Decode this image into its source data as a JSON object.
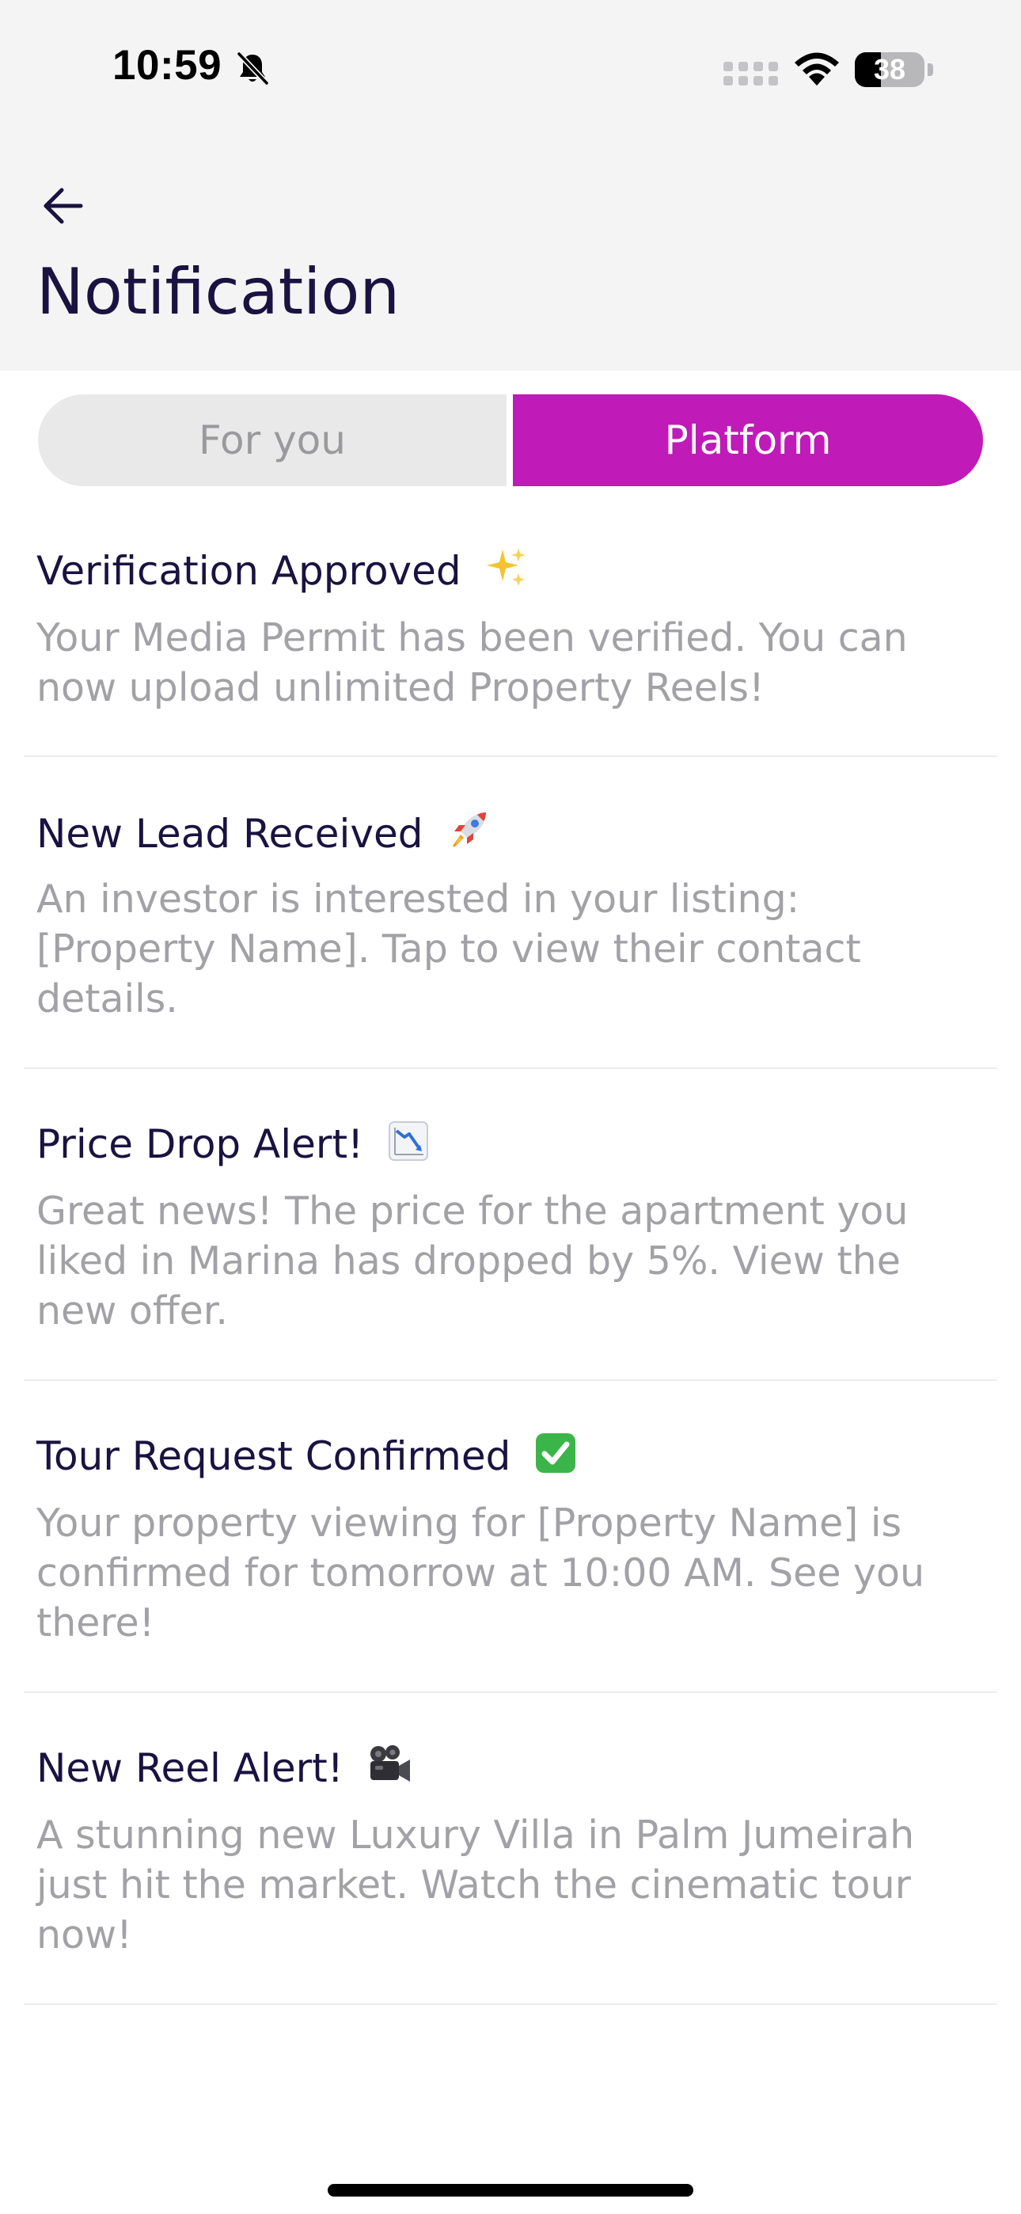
{
  "status_bar": {
    "time": "10:59",
    "battery_level": "38",
    "battery_fraction": 0.38,
    "icons": [
      "bell-slash-icon",
      "cellular-signal-icon",
      "wifi-icon",
      "battery-icon"
    ]
  },
  "header": {
    "back_icon": "arrow-left-icon",
    "title": "Notification"
  },
  "tabs": [
    {
      "label": "For you",
      "selected": false
    },
    {
      "label": "Platform",
      "selected": true
    }
  ],
  "colors": {
    "accent": "#c01ab8",
    "title_text": "#1a1240",
    "body_text": "#a2a2a6",
    "header_bg": "#f4f4f5"
  },
  "notifications": [
    {
      "title": "Verification Approved",
      "emoji": "sparkles-icon",
      "body": "Your Media Permit has been verified. You can now upload unlimited Property Reels!"
    },
    {
      "title": "New Lead Received",
      "emoji": "rocket-icon",
      "body": "An investor is interested in your listing: [Property Name]. Tap to view their contact details."
    },
    {
      "title": "Price Drop Alert!",
      "emoji": "chart-decreasing-icon",
      "body": "Great news! The price for the apartment you liked in Marina has dropped by 5%. View the new offer."
    },
    {
      "title": "Tour Request Confirmed",
      "emoji": "check-mark-button-icon",
      "body": "Your property viewing for [Property Name] is confirmed for tomorrow at 10:00 AM. See you there!"
    },
    {
      "title": "New Reel Alert!",
      "emoji": "movie-camera-icon",
      "body": "A stunning new Luxury Villa in Palm Jumeirah just hit the market. Watch the cinematic tour now!"
    }
  ]
}
